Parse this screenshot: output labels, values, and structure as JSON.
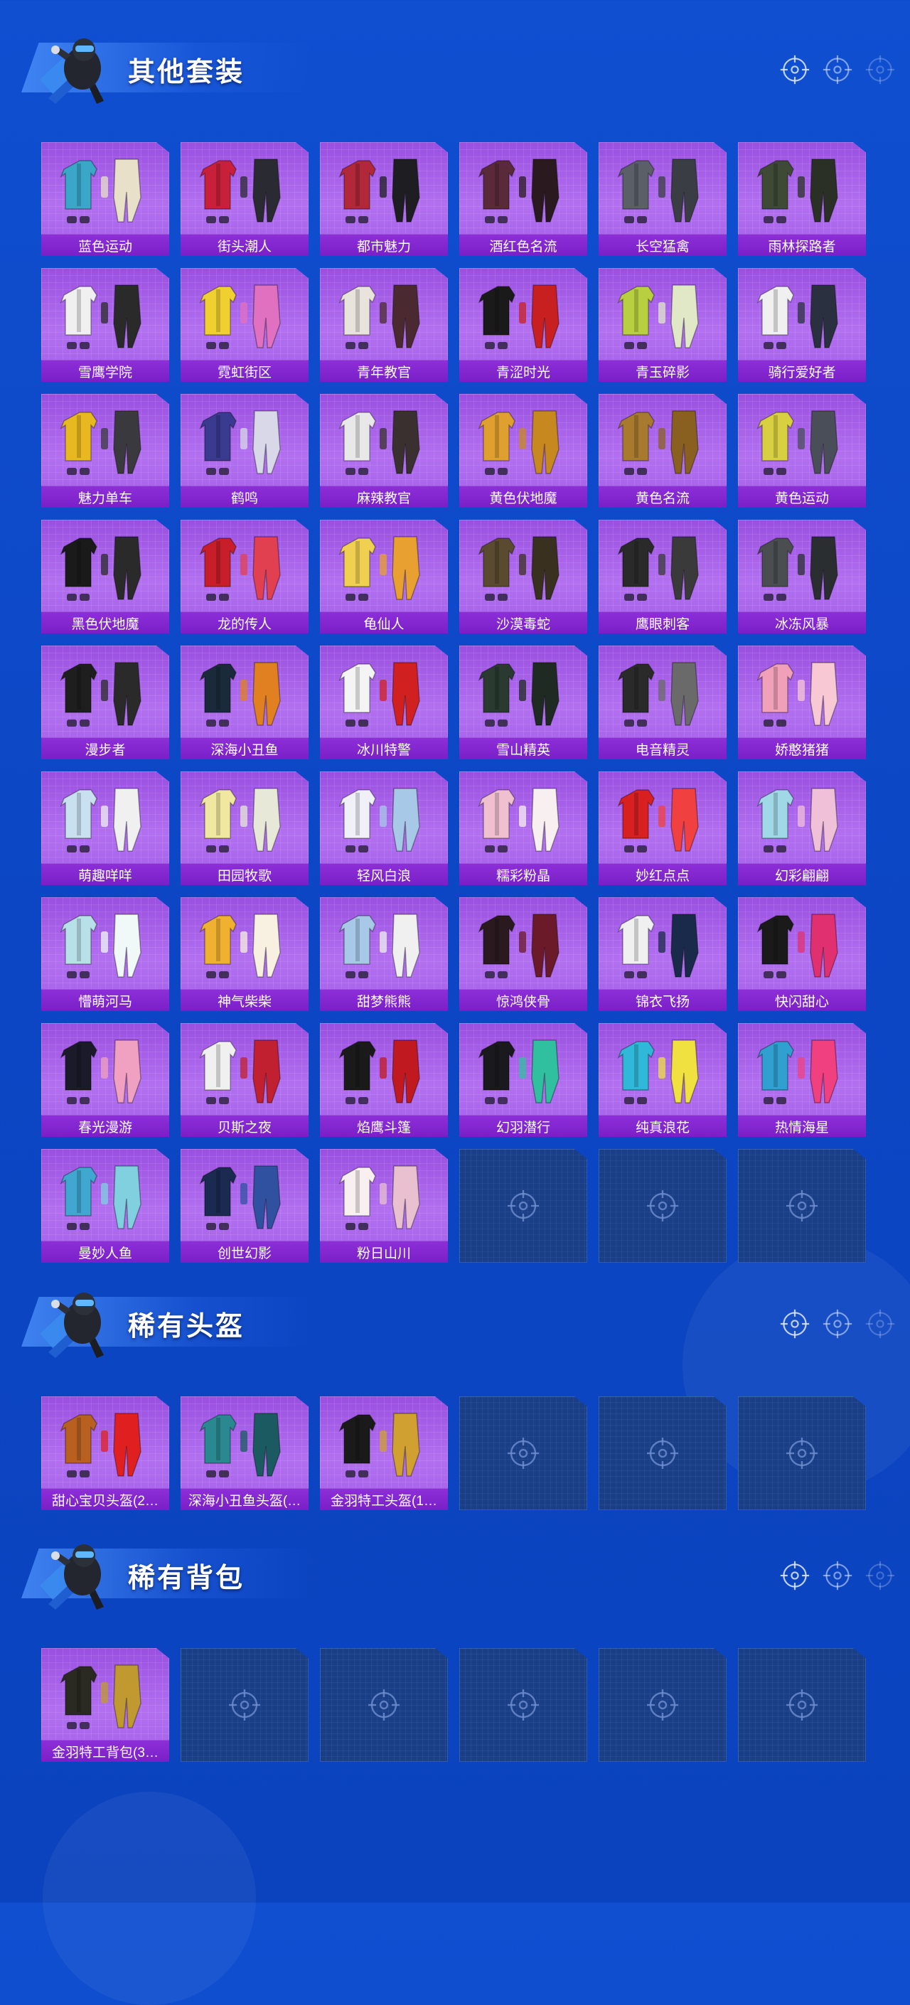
{
  "sections": [
    {
      "title": "其他套装",
      "items": [
        {
          "label": "蓝色运动",
          "c1": "#3aa6c8",
          "c2": "#e8e0c8"
        },
        {
          "label": "街头潮人",
          "c1": "#c8203a",
          "c2": "#2a2a32"
        },
        {
          "label": "都市魅力",
          "c1": "#b0283a",
          "c2": "#1e1e22"
        },
        {
          "label": "酒红色名流",
          "c1": "#5a2a3a",
          "c2": "#2a1a20"
        },
        {
          "label": "长空猛禽",
          "c1": "#5a5f68",
          "c2": "#3a3e44"
        },
        {
          "label": "雨林探路者",
          "c1": "#3e4a36",
          "c2": "#2a3026"
        },
        {
          "label": "雪鹰学院",
          "c1": "#f0f0f0",
          "c2": "#2a2a2a"
        },
        {
          "label": "霓虹街区",
          "c1": "#f0d030",
          "c2": "#e070c0"
        },
        {
          "label": "青年教官",
          "c1": "#e8e4dc",
          "c2": "#4a2a30"
        },
        {
          "label": "青涩时光",
          "c1": "#1a1a1a",
          "c2": "#c82020"
        },
        {
          "label": "青玉碎影",
          "c1": "#b8d040",
          "c2": "#e0e8c8"
        },
        {
          "label": "骑行爱好者",
          "c1": "#f0f0f0",
          "c2": "#2a3040"
        },
        {
          "label": "魅力单车",
          "c1": "#e8b820",
          "c2": "#3a3a3e"
        },
        {
          "label": "鹤鸣",
          "c1": "#3a3a90",
          "c2": "#d8d8e8"
        },
        {
          "label": "麻辣教官",
          "c1": "#e8e8e8",
          "c2": "#3a3030"
        },
        {
          "label": "黄色伏地魔",
          "c1": "#e0a030",
          "c2": "#c88820"
        },
        {
          "label": "黄色名流",
          "c1": "#a87a30",
          "c2": "#8a6020"
        },
        {
          "label": "黄色运动",
          "c1": "#d8d040",
          "c2": "#4a4e58"
        },
        {
          "label": "黑色伏地魔",
          "c1": "#1a1a1a",
          "c2": "#2a2a2a"
        },
        {
          "label": "龙的传人",
          "c1": "#c81e2a",
          "c2": "#e04050"
        },
        {
          "label": "龟仙人",
          "c1": "#f0d050",
          "c2": "#e8a030"
        },
        {
          "label": "沙漠毒蛇",
          "c1": "#5a4a30",
          "c2": "#3a3020"
        },
        {
          "label": "鹰眼刺客",
          "c1": "#2a2a2a",
          "c2": "#3a3a3a"
        },
        {
          "label": "冰冻风暴",
          "c1": "#4a4e50",
          "c2": "#2a2e30"
        },
        {
          "label": "漫步者",
          "c1": "#1e1e1e",
          "c2": "#2a2a2a"
        },
        {
          "label": "深海小丑鱼",
          "c1": "#1a2a3a",
          "c2": "#e08020"
        },
        {
          "label": "冰川特警",
          "c1": "#f4f4f4",
          "c2": "#d02020"
        },
        {
          "label": "雪山精英",
          "c1": "#2a3a30",
          "c2": "#1e2a22"
        },
        {
          "label": "电音精灵",
          "c1": "#2a2a2a",
          "c2": "#6a6a6a"
        },
        {
          "label": "娇憨猪猪",
          "c1": "#f0a0b8",
          "c2": "#f8c8d4"
        },
        {
          "label": "萌趣咩咩",
          "c1": "#c8e0f0",
          "c2": "#f0f0f0"
        },
        {
          "label": "田园牧歌",
          "c1": "#f0e8a0",
          "c2": "#e8e8d8"
        },
        {
          "label": "轻风白浪",
          "c1": "#f0f0f8",
          "c2": "#a8c8e8"
        },
        {
          "label": "糯彩粉晶",
          "c1": "#f0c0d0",
          "c2": "#f8f0f0"
        },
        {
          "label": "妙红点点",
          "c1": "#d82020",
          "c2": "#f04040"
        },
        {
          "label": "幻彩翩翩",
          "c1": "#a0d8e8",
          "c2": "#f0c0d8"
        },
        {
          "label": "懵萌河马",
          "c1": "#b8e0e8",
          "c2": "#f0f8f8"
        },
        {
          "label": "神气柴柴",
          "c1": "#f0b030",
          "c2": "#f8f0e0"
        },
        {
          "label": "甜梦熊熊",
          "c1": "#a8c8e8",
          "c2": "#f0f0f0"
        },
        {
          "label": "惊鸿侠骨",
          "c1": "#2a1a20",
          "c2": "#6a1a28"
        },
        {
          "label": "锦衣飞扬",
          "c1": "#f0f0f0",
          "c2": "#1a2a4a"
        },
        {
          "label": "快闪甜心",
          "c1": "#1a1a1a",
          "c2": "#e03070"
        },
        {
          "label": "春光漫游",
          "c1": "#1a1a2a",
          "c2": "#f0a0c0"
        },
        {
          "label": "贝斯之夜",
          "c1": "#f0f0f0",
          "c2": "#c02030"
        },
        {
          "label": "焰鹰斗篷",
          "c1": "#1a1a1a",
          "c2": "#c01a20"
        },
        {
          "label": "幻羽潜行",
          "c1": "#1a1a1e",
          "c2": "#30c0a0"
        },
        {
          "label": "纯真浪花",
          "c1": "#30b8d8",
          "c2": "#f0e040"
        },
        {
          "label": "热情海星",
          "c1": "#30a0d0",
          "c2": "#f04080"
        },
        {
          "label": "曼妙人鱼",
          "c1": "#40a8d0",
          "c2": "#80d0e0"
        },
        {
          "label": "创世幻影",
          "c1": "#1a2a50",
          "c2": "#3050a0"
        },
        {
          "label": "粉日山川",
          "c1": "#f8f0f0",
          "c2": "#e8c0d0"
        }
      ],
      "empty_slots": 3
    },
    {
      "title": "稀有头盔",
      "items": [
        {
          "label": "甜心宝贝头盔(2…",
          "c1": "#b86020",
          "c2": "#e02020"
        },
        {
          "label": "深海小丑鱼头盔(…",
          "c1": "#2a8890",
          "c2": "#1a5a60"
        },
        {
          "label": "金羽特工头盔(1…",
          "c1": "#1a1a1a",
          "c2": "#d0a030"
        }
      ],
      "empty_slots": 3
    },
    {
      "title": "稀有背包",
      "items": [
        {
          "label": "金羽特工背包(3…",
          "c1": "#2a2a22",
          "c2": "#c09a30"
        }
      ],
      "empty_slots": 5
    }
  ]
}
